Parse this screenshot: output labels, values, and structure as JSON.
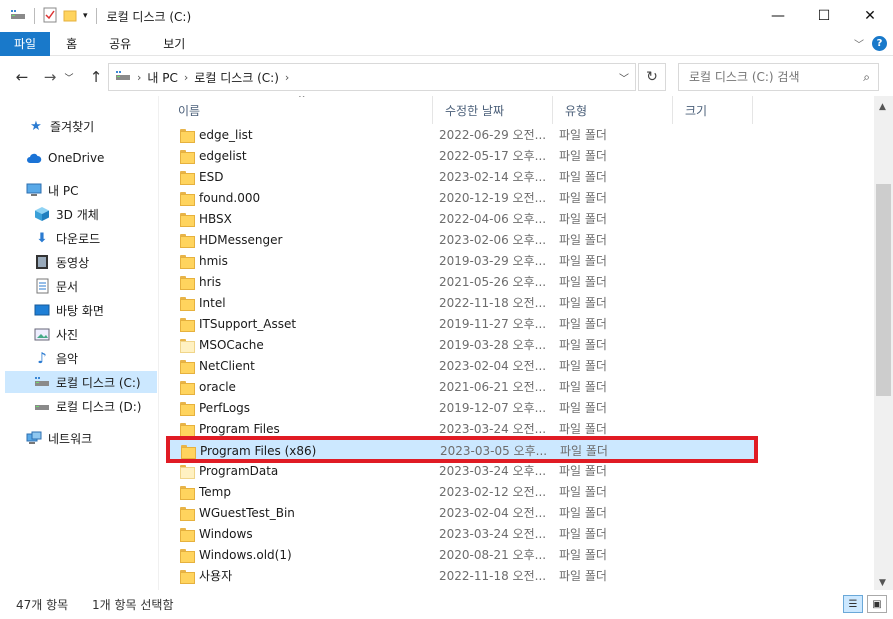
{
  "window": {
    "title": "로컬 디스크 (C:)",
    "minimize": "—",
    "maximize": "☐",
    "close": "✕"
  },
  "ribbon": {
    "tabs": [
      "파일",
      "홈",
      "공유",
      "보기"
    ]
  },
  "address": {
    "crumbs": [
      "내 PC",
      "로컬 디스크 (C:)"
    ],
    "search_placeholder": "로컬 디스크 (C:) 검색"
  },
  "nav": {
    "items": [
      {
        "label": "즐겨찾기",
        "icon": "star-icon"
      },
      {
        "label": "OneDrive",
        "icon": "cloud-icon"
      },
      {
        "label": "내 PC",
        "icon": "computer-icon"
      },
      {
        "label": "3D 개체",
        "icon": "cube-icon"
      },
      {
        "label": "다운로드",
        "icon": "download-icon"
      },
      {
        "label": "동영상",
        "icon": "video-icon"
      },
      {
        "label": "문서",
        "icon": "document-icon"
      },
      {
        "label": "바탕 화면",
        "icon": "desktop-icon"
      },
      {
        "label": "사진",
        "icon": "picture-icon"
      },
      {
        "label": "음악",
        "icon": "music-icon"
      },
      {
        "label": "로컬 디스크 (C:)",
        "icon": "drive-icon"
      },
      {
        "label": "로컬 디스크 (D:)",
        "icon": "drive-icon"
      },
      {
        "label": "네트워크",
        "icon": "network-icon"
      }
    ]
  },
  "columns": {
    "name": "이름",
    "date": "수정한 날짜",
    "type": "유형",
    "size": "크기"
  },
  "files": [
    {
      "name": "edge_list",
      "date": "2022-06-29 오전...",
      "type": "파일 폴더"
    },
    {
      "name": "edgelist",
      "date": "2022-05-17 오후...",
      "type": "파일 폴더"
    },
    {
      "name": "ESD",
      "date": "2023-02-14 오후...",
      "type": "파일 폴더"
    },
    {
      "name": "found.000",
      "date": "2020-12-19 오전...",
      "type": "파일 폴더"
    },
    {
      "name": "HBSX",
      "date": "2022-04-06 오후...",
      "type": "파일 폴더"
    },
    {
      "name": "HDMessenger",
      "date": "2023-02-06 오후...",
      "type": "파일 폴더"
    },
    {
      "name": "hmis",
      "date": "2019-03-29 오후...",
      "type": "파일 폴더"
    },
    {
      "name": "hris",
      "date": "2021-05-26 오후...",
      "type": "파일 폴더"
    },
    {
      "name": "Intel",
      "date": "2022-11-18 오전...",
      "type": "파일 폴더"
    },
    {
      "name": "ITSupport_Asset",
      "date": "2019-11-27 오후...",
      "type": "파일 폴더"
    },
    {
      "name": "MSOCache",
      "date": "2019-03-28 오후...",
      "type": "파일 폴더"
    },
    {
      "name": "NetClient",
      "date": "2023-02-04 오전...",
      "type": "파일 폴더"
    },
    {
      "name": "oracle",
      "date": "2021-06-21 오전...",
      "type": "파일 폴더"
    },
    {
      "name": "PerfLogs",
      "date": "2019-12-07 오후...",
      "type": "파일 폴더"
    },
    {
      "name": "Program Files",
      "date": "2023-03-24 오전...",
      "type": "파일 폴더"
    },
    {
      "name": "Program Files (x86)",
      "date": "2023-03-05 오후...",
      "type": "파일 폴더"
    },
    {
      "name": "ProgramData",
      "date": "2023-03-24 오후...",
      "type": "파일 폴더"
    },
    {
      "name": "Temp",
      "date": "2023-02-12 오전...",
      "type": "파일 폴더"
    },
    {
      "name": "WGuestTest_Bin",
      "date": "2023-02-04 오전...",
      "type": "파일 폴더"
    },
    {
      "name": "Windows",
      "date": "2023-03-24 오전...",
      "type": "파일 폴더"
    },
    {
      "name": "Windows.old(1)",
      "date": "2020-08-21 오후...",
      "type": "파일 폴더"
    },
    {
      "name": "사용자",
      "date": "2022-11-18 오전...",
      "type": "파일 폴더"
    }
  ],
  "status": {
    "count": "47개 항목",
    "selection": "1개 항목 선택함"
  }
}
